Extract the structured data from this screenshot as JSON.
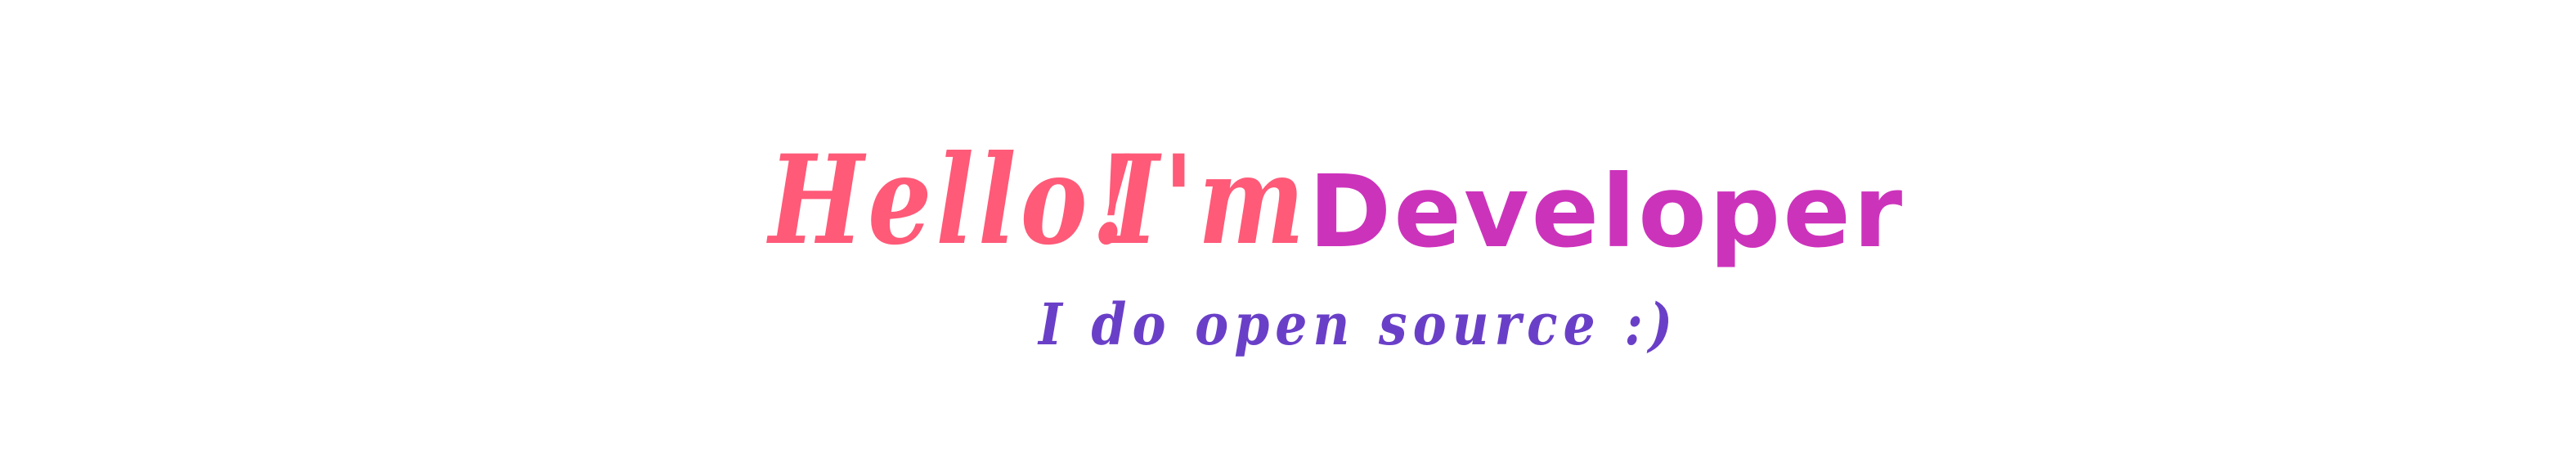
{
  "banner": {
    "greeting": "Hello!",
    "intro": "I'm",
    "role": "Developer",
    "tagline": "I do open source :)"
  },
  "colors": {
    "greeting": "#ff5a78",
    "role": "#cc33bb",
    "tagline": "#6a3fc8",
    "background": "#ffffff"
  }
}
